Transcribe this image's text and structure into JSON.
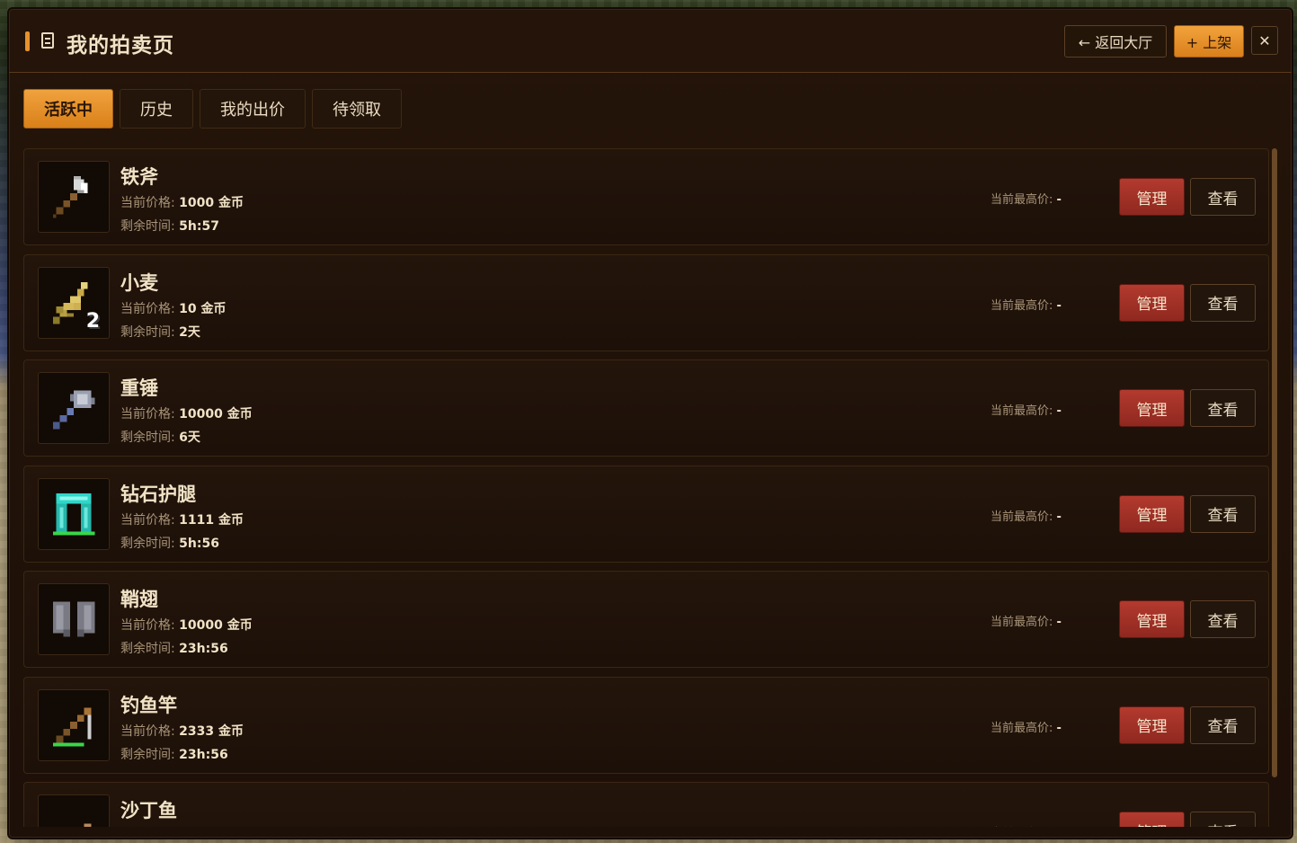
{
  "header": {
    "title": "我的拍卖页",
    "back_label": "← 返回大厅",
    "list_label": "+ 上架",
    "close_label": "✕"
  },
  "tabs": [
    {
      "label": "活跃中",
      "active": true
    },
    {
      "label": "历史"
    },
    {
      "label": "我的出价"
    },
    {
      "label": "待领取"
    }
  ],
  "labels": {
    "price_prefix": "当前价格: ",
    "time_prefix": "剩余时间: ",
    "bid_prefix": "当前最高价: ",
    "manage": "管理",
    "view": "查看"
  },
  "items": [
    {
      "name": "铁斧",
      "icon": "iron-axe-icon",
      "price": "1000 金币",
      "time": "5h:57",
      "bid": "-",
      "count": ""
    },
    {
      "name": "小麦",
      "icon": "wheat-icon",
      "price": "10 金币",
      "time": "2天",
      "bid": "-",
      "count": "2"
    },
    {
      "name": "重锤",
      "icon": "mace-icon",
      "price": "10000 金币",
      "time": "6天",
      "bid": "-",
      "count": ""
    },
    {
      "name": "钻石护腿",
      "icon": "diamond-leggings-icon",
      "price": "1111 金币",
      "time": "5h:56",
      "bid": "-",
      "count": ""
    },
    {
      "name": "鞘翅",
      "icon": "elytra-icon",
      "price": "10000 金币",
      "time": "23h:56",
      "bid": "-",
      "count": ""
    },
    {
      "name": "钓鱼竿",
      "icon": "fishing-rod-icon",
      "price": "2333 金币",
      "time": "23h:56",
      "bid": "-",
      "count": ""
    },
    {
      "name": "沙丁鱼",
      "icon": "sardine-icon",
      "price": "",
      "time": "",
      "bid": "-",
      "count": ""
    }
  ],
  "colors": {
    "accent": "#e8922a",
    "manage": "#b33a2e",
    "panel": "#1d1008"
  }
}
